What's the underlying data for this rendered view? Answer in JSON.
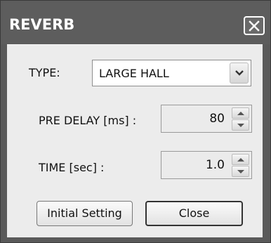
{
  "window": {
    "title": "REVERB",
    "close_icon": "close-x-icon"
  },
  "type": {
    "label": "TYPE:",
    "selected": "LARGE HALL",
    "dropdown_icon": "chevron-down-icon"
  },
  "pre_delay": {
    "label": "PRE DELAY [ms] :",
    "value": "80"
  },
  "time": {
    "label": "TIME [sec] :",
    "value": "1.0"
  },
  "buttons": {
    "initial_setting": "Initial Setting",
    "close": "Close"
  },
  "colors": {
    "titlebar": "#5d5d5d",
    "client_bg": "#ececec",
    "title_text": "#ffffff"
  }
}
